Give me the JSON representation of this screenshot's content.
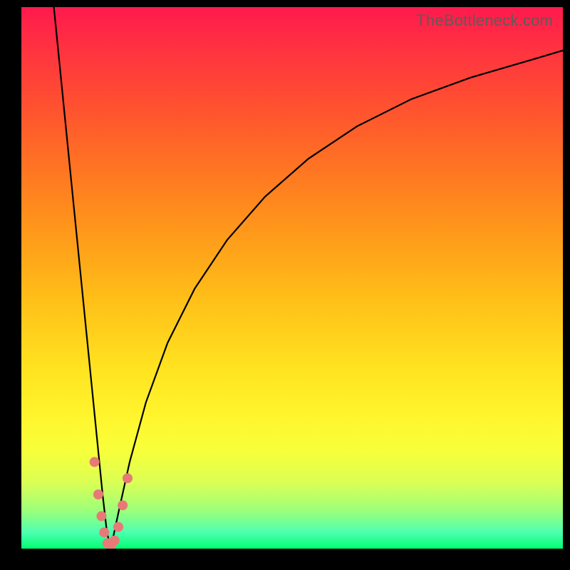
{
  "watermark": "TheBottleneck.com",
  "chart_data": {
    "type": "line",
    "title": "",
    "xlabel": "",
    "ylabel": "",
    "xlim": [
      0,
      100
    ],
    "ylim": [
      0,
      100
    ],
    "background_gradient": {
      "top_color": "#ff1a4d",
      "bottom_color": "#00ff73",
      "meaning": "red = high bottleneck, green = low bottleneck"
    },
    "series": [
      {
        "name": "left-branch",
        "description": "steep descending curve from top-left into the valley",
        "x": [
          6,
          7,
          8,
          9,
          10,
          11,
          12,
          13,
          14,
          15,
          15.8,
          16.5
        ],
        "y": [
          100,
          90,
          80,
          70,
          60,
          50,
          40,
          30,
          20,
          10,
          3,
          0
        ]
      },
      {
        "name": "right-branch",
        "description": "rising curve from valley toward upper-right, concave, asymptotic",
        "x": [
          16.5,
          18,
          20,
          23,
          27,
          32,
          38,
          45,
          53,
          62,
          72,
          83,
          95,
          100
        ],
        "y": [
          0,
          7,
          16,
          27,
          38,
          48,
          57,
          65,
          72,
          78,
          83,
          87,
          90.5,
          92
        ]
      }
    ],
    "valley_x": 16.5,
    "markers": {
      "description": "salmon-colored dots clustered around the valley bottom",
      "color": "#e77a77",
      "points": [
        {
          "x": 13.5,
          "y": 16
        },
        {
          "x": 14.2,
          "y": 10
        },
        {
          "x": 14.8,
          "y": 6
        },
        {
          "x": 15.3,
          "y": 3
        },
        {
          "x": 15.9,
          "y": 1
        },
        {
          "x": 16.5,
          "y": 0.5
        },
        {
          "x": 17.2,
          "y": 1.5
        },
        {
          "x": 17.9,
          "y": 4
        },
        {
          "x": 18.7,
          "y": 8
        },
        {
          "x": 19.6,
          "y": 13
        }
      ]
    }
  }
}
